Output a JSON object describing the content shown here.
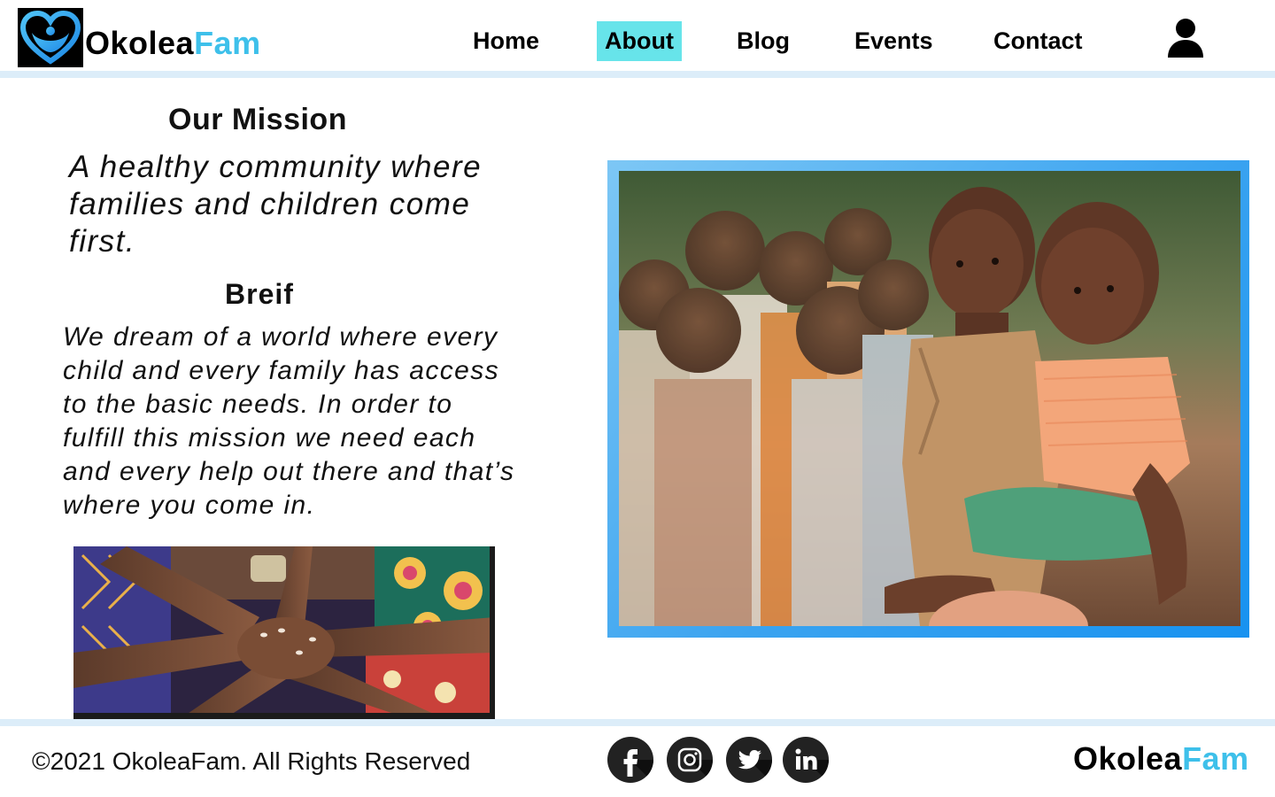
{
  "brand": {
    "name_part1": "Okolea",
    "name_part2": "Fam",
    "accent_color": "#3ec0ea"
  },
  "nav": {
    "items": [
      {
        "label": "Home",
        "active": false
      },
      {
        "label": "About",
        "active": true
      },
      {
        "label": "Blog",
        "active": false
      },
      {
        "label": "Events",
        "active": false
      },
      {
        "label": "Contact",
        "active": false
      }
    ],
    "active_color": "#67e4ea",
    "user_icon": "user-icon"
  },
  "mission": {
    "title": "Our Mission",
    "text": "A healthy community where families and children come first."
  },
  "brief": {
    "title": "Breif",
    "text": "We dream of a world where every child and every family has access to the basic needs. In order to fulfill this mission we need each and every help out there and that’s where you come in."
  },
  "images": {
    "hands": "hands-together-photo",
    "children": "children-photo"
  },
  "footer": {
    "copyright": "©2021 OkoleaFam. All Rights Reserved",
    "social": [
      "facebook-icon",
      "instagram-icon",
      "twitter-icon",
      "linkedin-icon"
    ]
  }
}
